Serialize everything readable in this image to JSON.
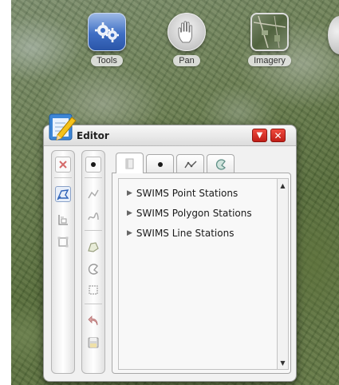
{
  "toolbar": {
    "items": [
      {
        "label": "Tools",
        "icon": "tools-gears-icon"
      },
      {
        "label": "Pan",
        "icon": "hand-icon"
      },
      {
        "label": "Imagery",
        "icon": "imagery-thumbnail-icon"
      }
    ]
  },
  "editor": {
    "title": "Editor",
    "collapse_icon": "▼",
    "close_icon": "✕",
    "column1": [
      "delete-icon",
      "select-lasso-icon",
      "attributes-icon",
      "vertices-icon"
    ],
    "column2": [
      "point-icon",
      "polyline-icon",
      "freehand-line-icon",
      "polygon-icon",
      "autocomplete-icon",
      "rectangle-icon",
      "undo-icon",
      "save-icon"
    ],
    "tabs": [
      "all-templates-tab",
      "point-tab",
      "line-tab",
      "polygon-tab"
    ],
    "layers": [
      {
        "label": "SWIMS Point Stations"
      },
      {
        "label": "SWIMS Polygon Stations"
      },
      {
        "label": "SWIMS Line Stations"
      }
    ]
  },
  "colors": {
    "window_button": "#d9261c",
    "accent_blue": "#3f6fc4"
  }
}
